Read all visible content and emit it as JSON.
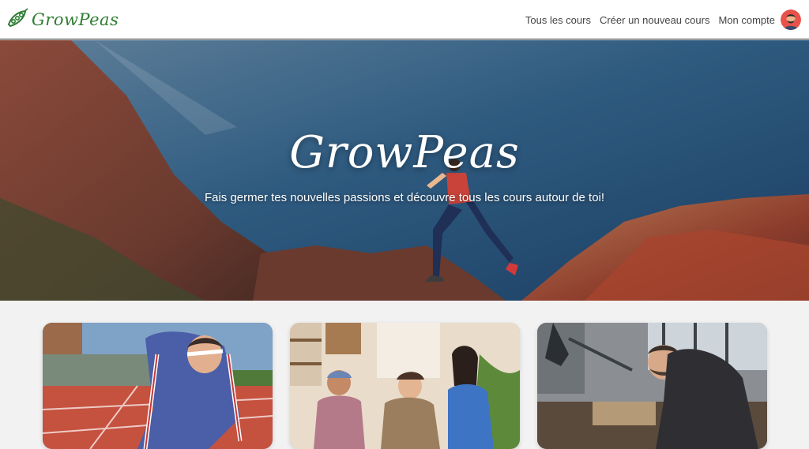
{
  "brand": {
    "name": "GrowPeas",
    "logo_icon": "pea-pod-icon",
    "color": "#2f7d32"
  },
  "nav": {
    "items": [
      {
        "label": "Tous les cours"
      },
      {
        "label": "Créer un nouveau cours"
      },
      {
        "label": "Mon compte"
      }
    ],
    "avatar_icon": "user-avatar-icon"
  },
  "hero": {
    "title": "GrowPeas",
    "subtitle": "Fais germer tes nouvelles passions et découvre tous les cours autour de toi!"
  },
  "courses": [
    {
      "image": "runner-on-track-photo"
    },
    {
      "image": "cooking-class-photo"
    },
    {
      "image": "workshop-craftsman-photo"
    }
  ]
}
